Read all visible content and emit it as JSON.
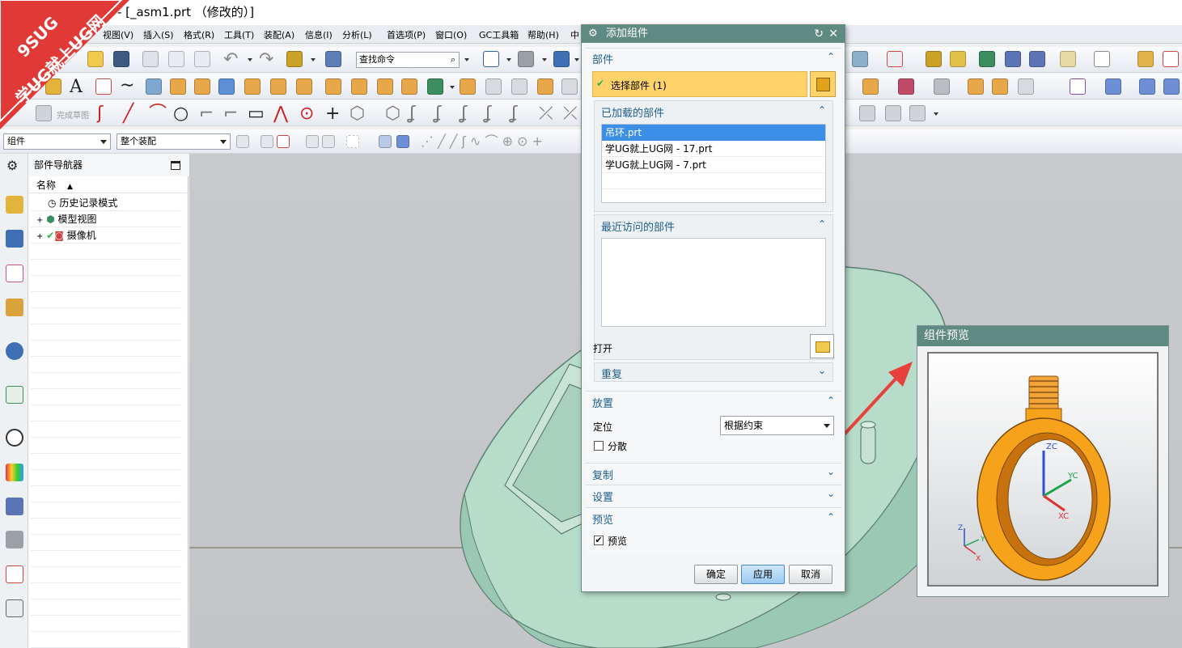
{
  "window": {
    "title": "- [_asm1.prt （修改的）]"
  },
  "watermark": {
    "line1": "9SUG",
    "line2": "学UG就上UG网"
  },
  "menu": [
    "视图(V)",
    "插入(S)",
    "格式(R)",
    "工具(T)",
    "装配(A)",
    "信息(I)",
    "分析(L)",
    "首选项(P)",
    "窗口(O)",
    "GC工具箱",
    "帮助(H)",
    "中"
  ],
  "toolbar": {
    "find_command": "查找命令",
    "finish_sketch": "完成草图",
    "filter_select": "组件",
    "assembly_scope": "整个装配"
  },
  "navigator": {
    "title": "部件导航器",
    "column": "名称",
    "items": [
      "历史记录模式",
      "模型视图",
      "摄像机"
    ]
  },
  "dialog": {
    "title": "添加组件",
    "section_part": "部件",
    "select_part": "选择部件 (1)",
    "loaded_parts_label": "已加载的部件",
    "loaded_parts": [
      "吊环.prt",
      "学UG就上UG网 - 17.prt",
      "学UG就上UG网 - 7.prt"
    ],
    "recent_parts_label": "最近访问的部件",
    "open_label": "打开",
    "repeat_label": "重复",
    "placement_label": "放置",
    "position_label": "定位",
    "position_value": "根据约束",
    "scatter_label": "分散",
    "copy_label": "复制",
    "settings_label": "设置",
    "preview_section_label": "预览",
    "preview_checkbox_label": "预览",
    "preview_checked": true,
    "scatter_checked": false,
    "buttons": {
      "ok": "确定",
      "apply": "应用",
      "cancel": "取消"
    }
  },
  "preview_window": {
    "title": "组件预览",
    "axes": {
      "zc": "ZC",
      "yc": "YC",
      "xc": "XC",
      "z": "Z",
      "y": "Y",
      "x": "X"
    }
  },
  "colors": {
    "dialog_title": "#5f8a82",
    "selected_row": "#3d8ee6",
    "highlight": "#ffd36a",
    "part_green": "#b9dcc8",
    "ring_orange": "#f7a21b",
    "arrow_red": "#e8403a"
  }
}
